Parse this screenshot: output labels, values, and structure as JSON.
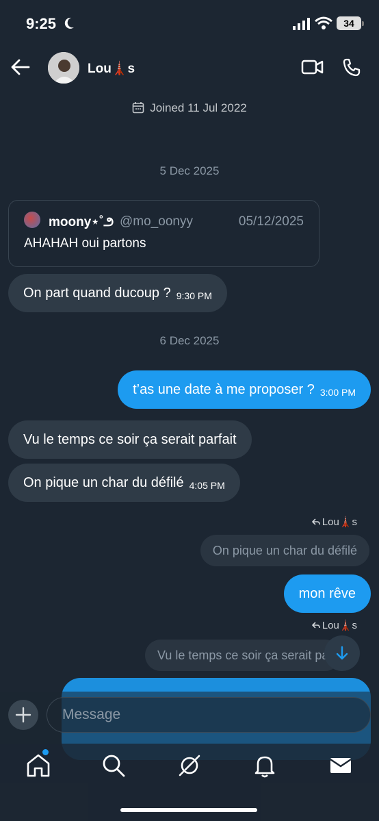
{
  "status_bar": {
    "time": "9:25",
    "battery": "34"
  },
  "header": {
    "name": "Lou🗼s"
  },
  "joined": "Joined 11 Jul 2022",
  "dates": {
    "first": "5 Dec 2025",
    "second": "6 Dec 2025"
  },
  "quote_card": {
    "name": "moony⋆˚౨",
    "handle": "@mo_oonyy",
    "date": "05/12/2025",
    "text": "AHAHAH oui partons"
  },
  "messages": [
    {
      "text": "On part quand ducoup ?",
      "time": "9:30 PM"
    },
    {
      "text": "t’as une date à me proposer ?",
      "time": "3:00 PM"
    },
    {
      "text": "Vu le temps ce soir ça serait parfait"
    },
    {
      "text": "On pique un char du défilé",
      "time": "4:05 PM"
    },
    {
      "text": "mon rêve"
    }
  ],
  "replies": [
    {
      "label": "Lou🗼s",
      "quote": "On pique un char du défilé"
    },
    {
      "label": "Lou🗼s",
      "quote": "Vu le temps ce soir ça serait parfait"
    }
  ],
  "composer": {
    "placeholder": "Message"
  },
  "colors": {
    "background": "#1c2632",
    "accent": "#1d9bf0",
    "incoming": "#2f3b47"
  },
  "icons": [
    "back-arrow-icon",
    "video-call-icon",
    "phone-icon",
    "calendar-icon",
    "reply-icon",
    "chevron-down-icon",
    "plus-icon",
    "home-icon",
    "search-icon",
    "grok-icon",
    "bell-icon",
    "mail-icon"
  ]
}
